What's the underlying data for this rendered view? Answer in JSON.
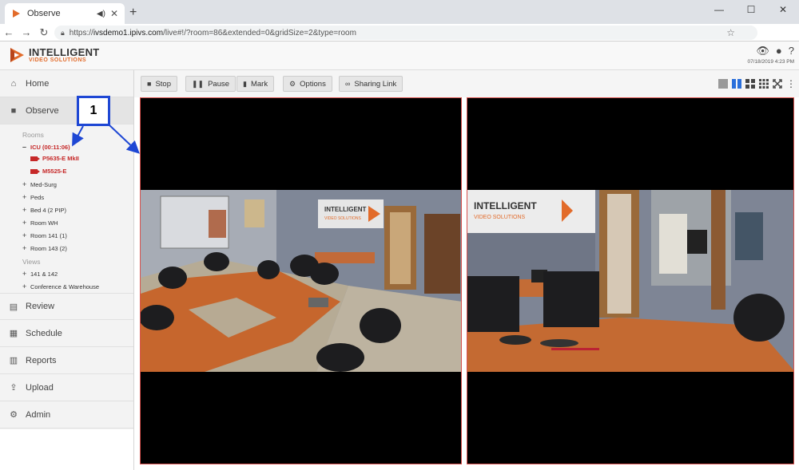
{
  "browser": {
    "tab_title": "Observe",
    "url_scheme": "https://",
    "url_host": "ivsdemo1.ipivs.com",
    "url_path": "/live#!/?room=86&extended=0&gridSize=2&type=room",
    "profile_initial": "D"
  },
  "header": {
    "logo_line1": "INTELLIGENT",
    "logo_line2": "VIDEO SOLUTIONS",
    "datetime": "07/18/2019 4:23 PM"
  },
  "sidebar": {
    "items": [
      {
        "label": "Home",
        "icon": "home-icon"
      },
      {
        "label": "Observe",
        "icon": "video-camera-icon"
      },
      {
        "label": "Review",
        "icon": "film-icon"
      },
      {
        "label": "Schedule",
        "icon": "calendar-icon"
      },
      {
        "label": "Reports",
        "icon": "bar-chart-icon"
      },
      {
        "label": "Upload",
        "icon": "upload-icon"
      },
      {
        "label": "Admin",
        "icon": "gear-icon"
      }
    ],
    "rooms_header": "Rooms",
    "active_room": "ICU (00:11:06)",
    "active_cameras": [
      "P5635-E MkII",
      "M5525-E"
    ],
    "rooms": [
      "Med-Surg",
      "Peds",
      "Bed 4 (2 PIP)",
      "Room WH",
      "Room 141 (1)",
      "Room 143 (2)"
    ],
    "views_header": "Views",
    "views": [
      "141 & 142",
      "Conference & Warehouse"
    ]
  },
  "toolbar": {
    "stop": "Stop",
    "pause": "Pause",
    "mark": "Mark",
    "options": "Options",
    "sharing_link": "Sharing Link"
  },
  "annotation": {
    "number": "1"
  },
  "video": {
    "left_sign_line1": "INTELLIGENT",
    "left_sign_line2": "VIDEO SOLUTIONS",
    "right_sign_line1": "INTELLIGENT",
    "right_sign_line2": "VIDEO SOLUTIONS"
  },
  "colors": {
    "accent_orange": "#e26b2a",
    "active_red": "#c62828",
    "annotation_blue": "#1e47d4",
    "tile_border": "#d9534f"
  }
}
